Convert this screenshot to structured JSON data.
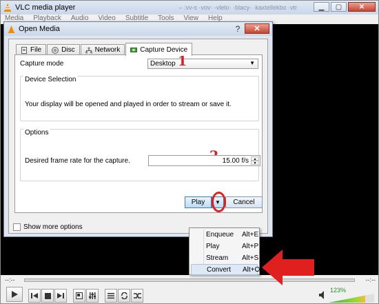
{
  "app": {
    "title": "VLC media player",
    "title_blur": "– :vv-s ·vov· -vlelo· ·blacy· ·kaxtellekbo ·vtr",
    "menu": [
      "Media",
      "Playback",
      "Audio",
      "Video",
      "Subtitle",
      "Tools",
      "View",
      "Help"
    ],
    "seek_left": "--:--",
    "seek_right": "--:--",
    "volume": "123%"
  },
  "dialog": {
    "title": "Open Media",
    "help": "?",
    "close": "✕",
    "tabs": [
      {
        "label": "File",
        "icon": "file-icon"
      },
      {
        "label": "Disc",
        "icon": "disc-icon"
      },
      {
        "label": "Network",
        "icon": "network-icon"
      },
      {
        "label": "Capture Device",
        "icon": "capture-device-icon"
      }
    ],
    "capture_mode_label": "Capture mode",
    "capture_mode_value": "Desktop",
    "device_selection_title": "Device Selection",
    "device_selection_text": "Your display will be opened and played in order to stream or save it.",
    "options_title": "Options",
    "frame_rate_label": "Desired frame rate for the capture.",
    "frame_rate_value": "15.00 f/s",
    "show_more_options": "Show more options",
    "play_label": "Play",
    "cancel_label": "Cancel"
  },
  "dropdown": [
    {
      "label": "Enqueue",
      "accel": "Alt+E"
    },
    {
      "label": "Play",
      "accel": "Alt+P"
    },
    {
      "label": "Stream",
      "accel": "Alt+S"
    },
    {
      "label": "Convert",
      "accel": "Alt+O"
    }
  ],
  "annotations": {
    "marker1": "1",
    "marker2": "2",
    "color": "#d42020"
  }
}
